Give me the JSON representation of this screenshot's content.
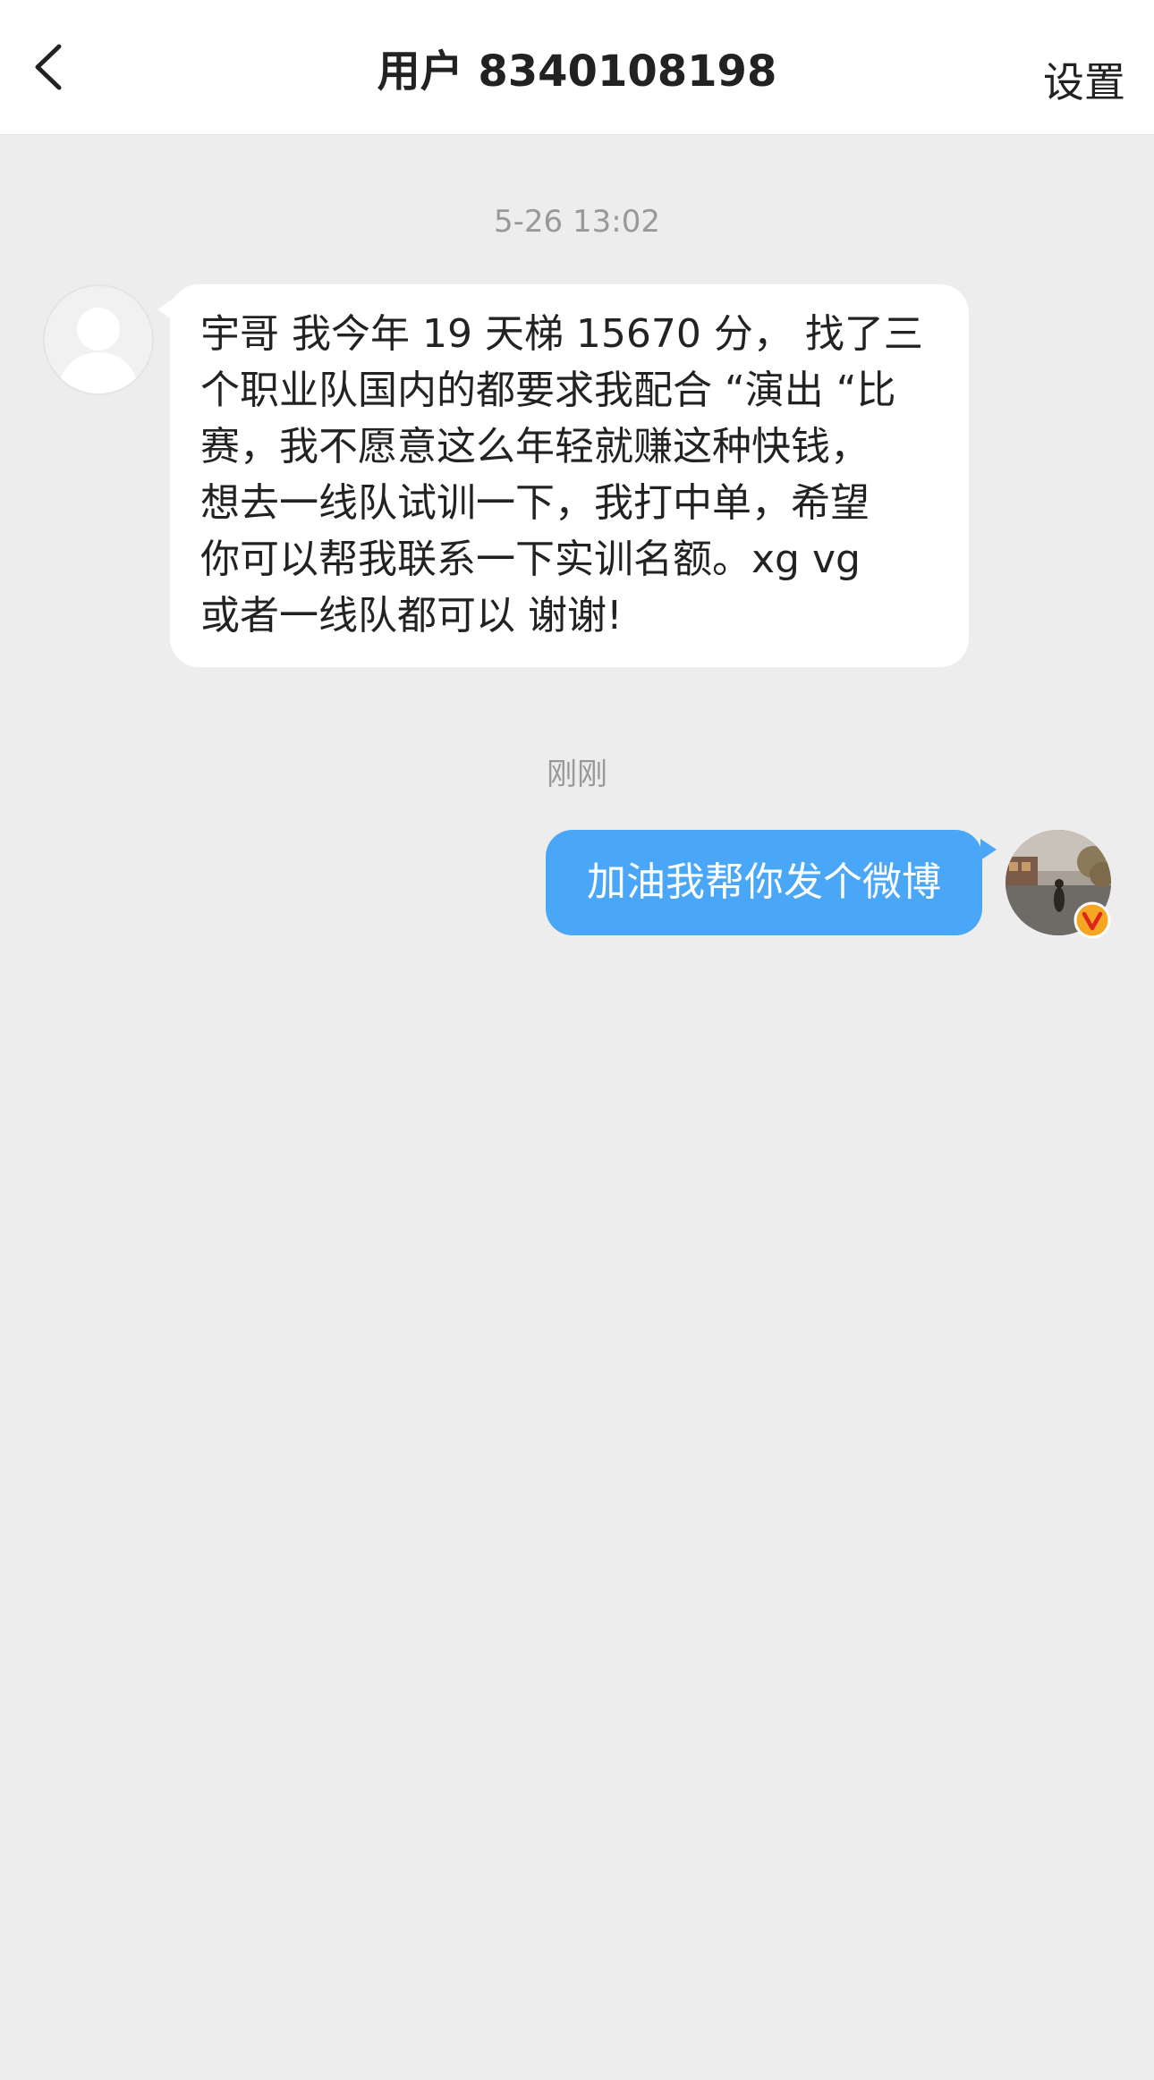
{
  "header": {
    "title": "用户 8340108198",
    "settings_label": "设置",
    "back_icon": "chevron-left-icon"
  },
  "messages": [
    {
      "timestamp": "5-26 13:02",
      "direction": "incoming",
      "avatar": "default-user-avatar",
      "lines": [
        "宇哥 我今年 19 天梯 15670 分， 找了三",
        "个职业队国内的都要求我配合 “演出 “比",
        "赛，我不愿意这么年轻就赚这种快钱，",
        "想去一线队试训一下，我打中单，希望",
        "你可以帮我联系一下实训名额。xg vg",
        "或者一线队都可以 谢谢!"
      ]
    },
    {
      "timestamp": "刚刚",
      "direction": "outgoing",
      "avatar": "user-photo-avatar",
      "badge": "verified-v-badge",
      "text": "加油我帮你发个微博"
    }
  ],
  "colors": {
    "background": "#ededed",
    "header_bg": "#ffffff",
    "incoming_bubble": "#ffffff",
    "outgoing_bubble": "#4aa6f6",
    "timestamp_text": "#999999",
    "badge_orange": "#f5a623"
  }
}
